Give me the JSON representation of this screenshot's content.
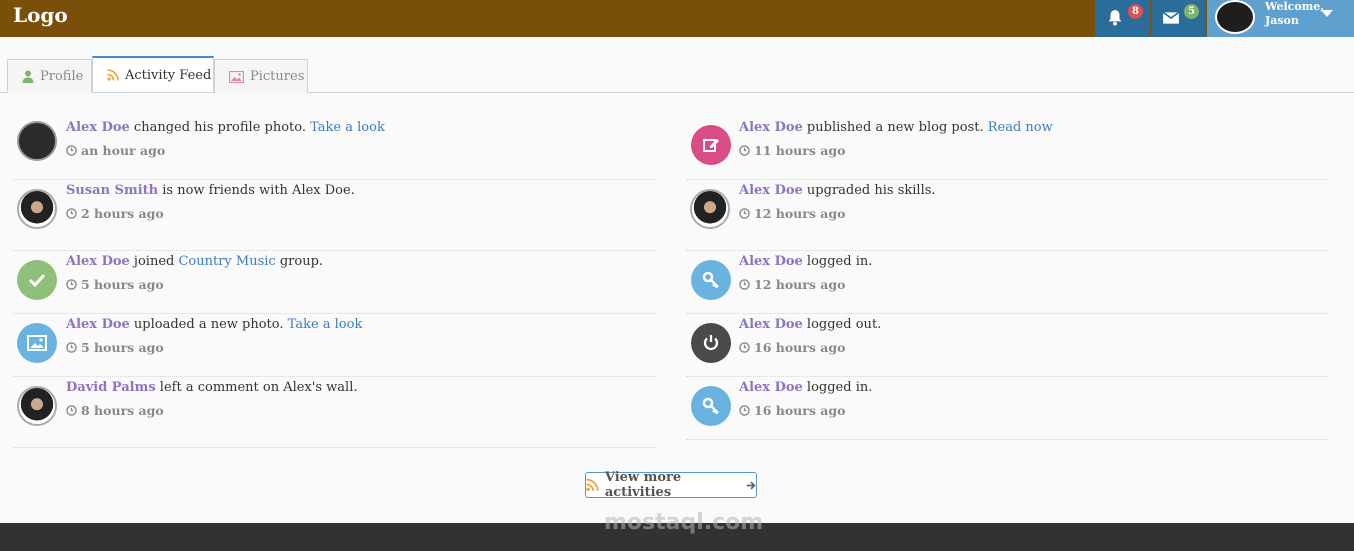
{
  "header": {
    "logo": "Logo",
    "notifications_count": "8",
    "messages_count": "5",
    "welcome_line1": "Welcome,",
    "welcome_line2": "Jason",
    "icons": [
      "bell-icon",
      "envelope-icon",
      "chevron-down-icon"
    ]
  },
  "tabs": [
    {
      "label": "Profile",
      "icon": "user-icon",
      "active": false
    },
    {
      "label": "Activity Feed",
      "icon": "rss-icon",
      "active": true
    },
    {
      "label": "Pictures",
      "icon": "image-icon",
      "active": false
    }
  ],
  "feed_left": [
    {
      "name": "Alex Doe",
      "text": " changed his profile photo. ",
      "link": "Take a look",
      "time": "an hour ago",
      "avatar": "photo"
    },
    {
      "name": "Susan Smith",
      "text": " is now friends with Alex Doe.",
      "link": "",
      "time": "2 hours ago",
      "avatar": "person"
    },
    {
      "name": "Alex Doe",
      "text": " joined ",
      "link": "Country Music",
      "suffix": " group.",
      "time": "5 hours ago",
      "avatar": "check-icon"
    },
    {
      "name": "Alex Doe",
      "text": " uploaded a new photo. ",
      "link": "Take a look",
      "time": "5 hours ago",
      "avatar": "image-icon"
    },
    {
      "name": "David Palms",
      "text": " left a comment on Alex's wall.",
      "link": "",
      "time": "8 hours ago",
      "avatar": "person"
    }
  ],
  "feed_right": [
    {
      "name": "Alex Doe",
      "text": " published a new blog post. ",
      "link": "Read now",
      "time": "11 hours ago",
      "avatar": "edit-icon"
    },
    {
      "name": "Alex Doe",
      "text": " upgraded his skills.",
      "link": "",
      "time": "12 hours ago",
      "avatar": "person"
    },
    {
      "name": "Alex Doe",
      "text": " logged in.",
      "link": "",
      "time": "12 hours ago",
      "avatar": "key-icon"
    },
    {
      "name": "Alex Doe",
      "text": " logged out.",
      "link": "",
      "time": "16 hours ago",
      "avatar": "power-icon"
    },
    {
      "name": "Alex Doe",
      "text": " logged in.",
      "link": "",
      "time": "16 hours ago",
      "avatar": "key-icon"
    }
  ],
  "more_button": "View more activities",
  "watermark": "mostaql.com",
  "colors": {
    "header": "#7a4f0a",
    "nav": "#2a6d9b",
    "user_nav": "#5fa0cf",
    "name": "#8e74c0",
    "link": "#3d7cc0"
  }
}
